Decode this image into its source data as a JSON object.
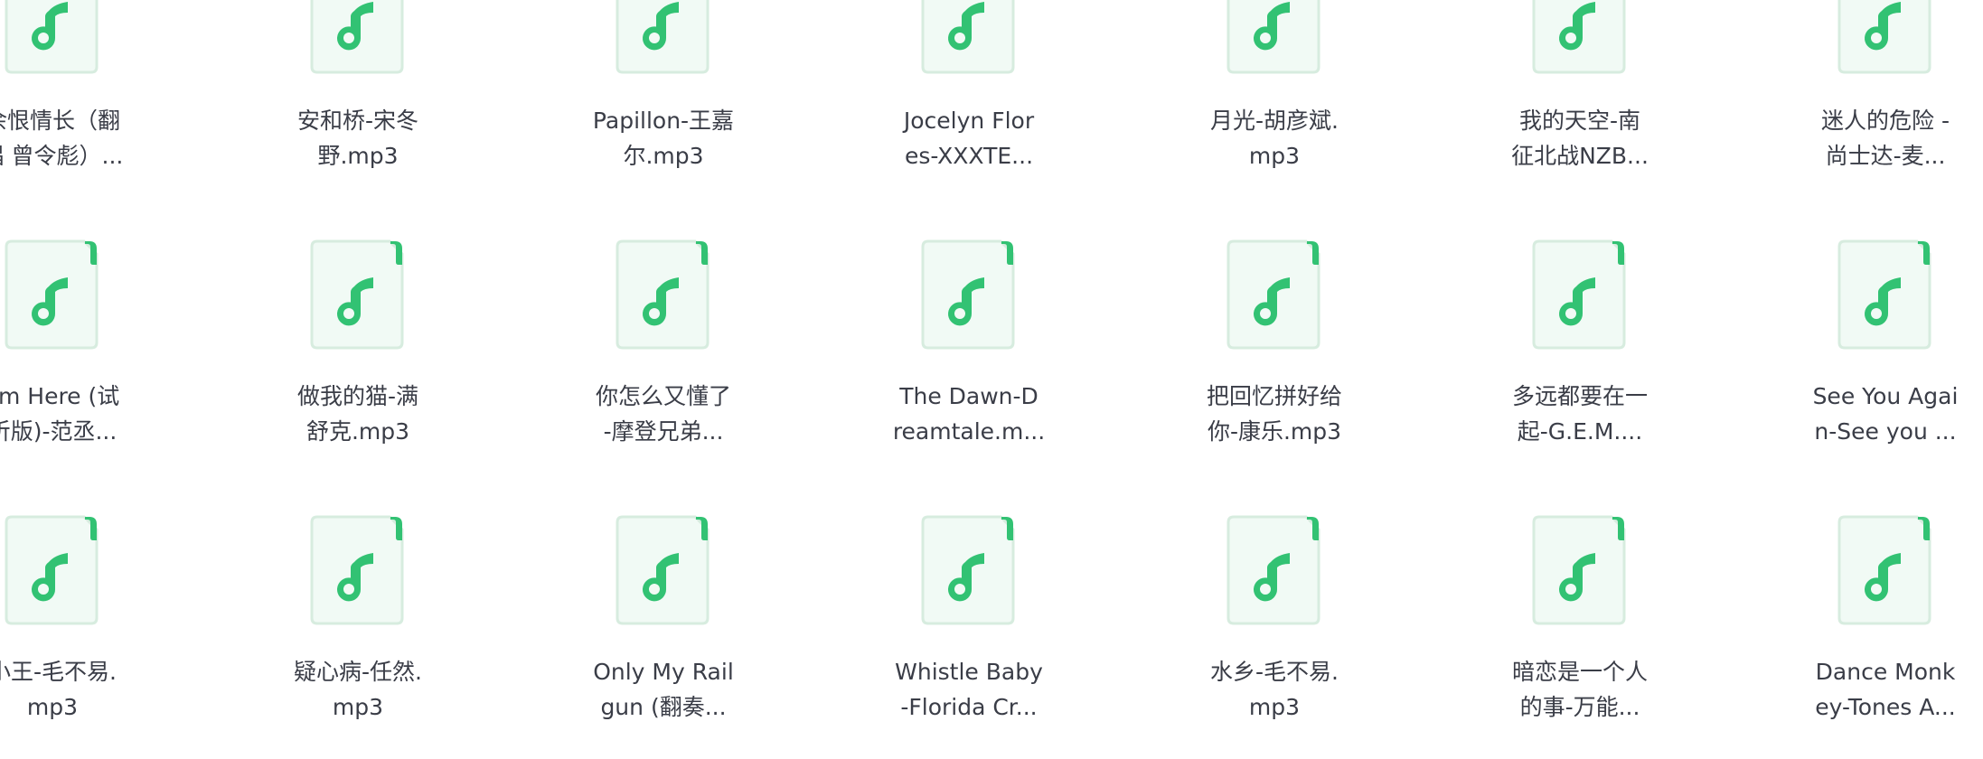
{
  "colors": {
    "icon_fill": "#f1faf5",
    "icon_border": "#d7ecdf",
    "icon_accent": "#32c273",
    "text": "#3a3d47"
  },
  "file_icon": "music-file-icon",
  "files": [
    {
      "line1": "余恨情长（翻",
      "line2": "唱 曾令彪）..."
    },
    {
      "line1": "安和桥-宋冬",
      "line2": "野.mp3"
    },
    {
      "line1": "Papillon-王嘉",
      "line2": "尔.mp3"
    },
    {
      "line1": "Jocelyn Flor",
      "line2": "es-XXXTE..."
    },
    {
      "line1": "月光-胡彦斌.",
      "line2": "mp3"
    },
    {
      "line1": "我的天空-南",
      "line2": "征北战NZB..."
    },
    {
      "line1": "迷人的危险 -",
      "line2": "尚士达-麦..."
    },
    {
      "line1": "I'm Here (试",
      "line2": "听版)-范丞..."
    },
    {
      "line1": "做我的猫-满",
      "line2": "舒克.mp3"
    },
    {
      "line1": "你怎么又懂了",
      "line2": "-摩登兄弟..."
    },
    {
      "line1": "The Dawn-D",
      "line2": "reamtale.m..."
    },
    {
      "line1": "把回忆拼好给",
      "line2": "你-康乐.mp3"
    },
    {
      "line1": "多远都要在一",
      "line2": "起-G.E.M...."
    },
    {
      "line1": "See You Agai",
      "line2": "n-See you ..."
    },
    {
      "line1": "小王-毛不易.",
      "line2": "mp3"
    },
    {
      "line1": "疑心病-任然.",
      "line2": "mp3"
    },
    {
      "line1": "Only My Rail",
      "line2": "gun (翻奏..."
    },
    {
      "line1": "Whistle Baby",
      "line2": "-Florida Cr..."
    },
    {
      "line1": "水乡-毛不易.",
      "line2": "mp3"
    },
    {
      "line1": "暗恋是一个人",
      "line2": "的事-万能..."
    },
    {
      "line1": "Dance Monk",
      "line2": "ey-Tones A..."
    }
  ]
}
